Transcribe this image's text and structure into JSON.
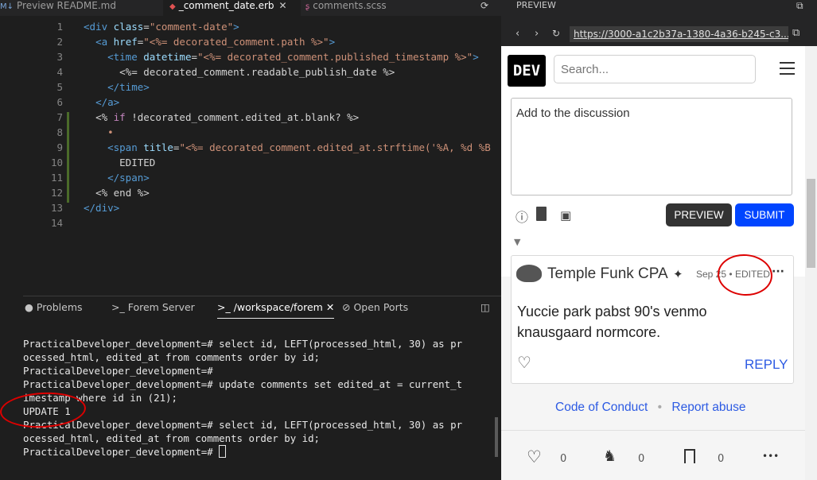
{
  "editor": {
    "tabs": [
      {
        "label": "Preview README.md",
        "icon": "markdown-icon"
      },
      {
        "label": "_comment_date.erb",
        "icon": "ruby-icon"
      },
      {
        "label": "comments.scss",
        "icon": "sass-icon"
      }
    ],
    "line_numbers": [
      "1",
      "2",
      "3",
      "4",
      "5",
      "6",
      "7",
      "8",
      "9",
      "10",
      "11",
      "12",
      "13",
      "14"
    ]
  },
  "panel": {
    "tabs": [
      "Problems",
      "Forem Server",
      "/workspace/forem",
      "Open Ports"
    ],
    "terminal_lines": [
      "PracticalDeveloper_development=# select id, LEFT(processed_html, 30) as pr",
      "ocessed_html, edited_at from comments order by id;",
      "PracticalDeveloper_development=#",
      "PracticalDeveloper_development=# update comments set edited_at = current_t",
      "imestamp where id in (21);",
      "UPDATE 1",
      "PracticalDeveloper_development=# select id, LEFT(processed_html, 30) as pr",
      "ocessed_html, edited_at from comments order by id;",
      "PracticalDeveloper_development=# "
    ]
  },
  "preview": {
    "title": "PREVIEW",
    "url": "https://3000-a1c2b37a-1380-4a36-b245-c3..."
  },
  "dev": {
    "logo": "DEV",
    "search_placeholder": "Search...",
    "textarea_placeholder": "Add to the discussion",
    "preview_label": "PREVIEW",
    "submit_label": "SUBMIT",
    "comment": {
      "author": "Temple Funk CPA",
      "date": "Sep 25",
      "separator": "•",
      "edited": "EDITED",
      "more": "···",
      "body_line1": "Yuccie park pabst 90's venmo",
      "body_line2": "knausgaard normcore.",
      "reply": "REPLY"
    },
    "footer": {
      "code_of_conduct": "Code of Conduct",
      "dot": "•",
      "report_abuse": "Report abuse"
    },
    "bottom_bar": {
      "likes": "0",
      "unicorns": "0",
      "bookmarks": "0",
      "more": "•••"
    }
  },
  "colors": {
    "accent": "#0045ff",
    "annotation": "#dd0000"
  }
}
